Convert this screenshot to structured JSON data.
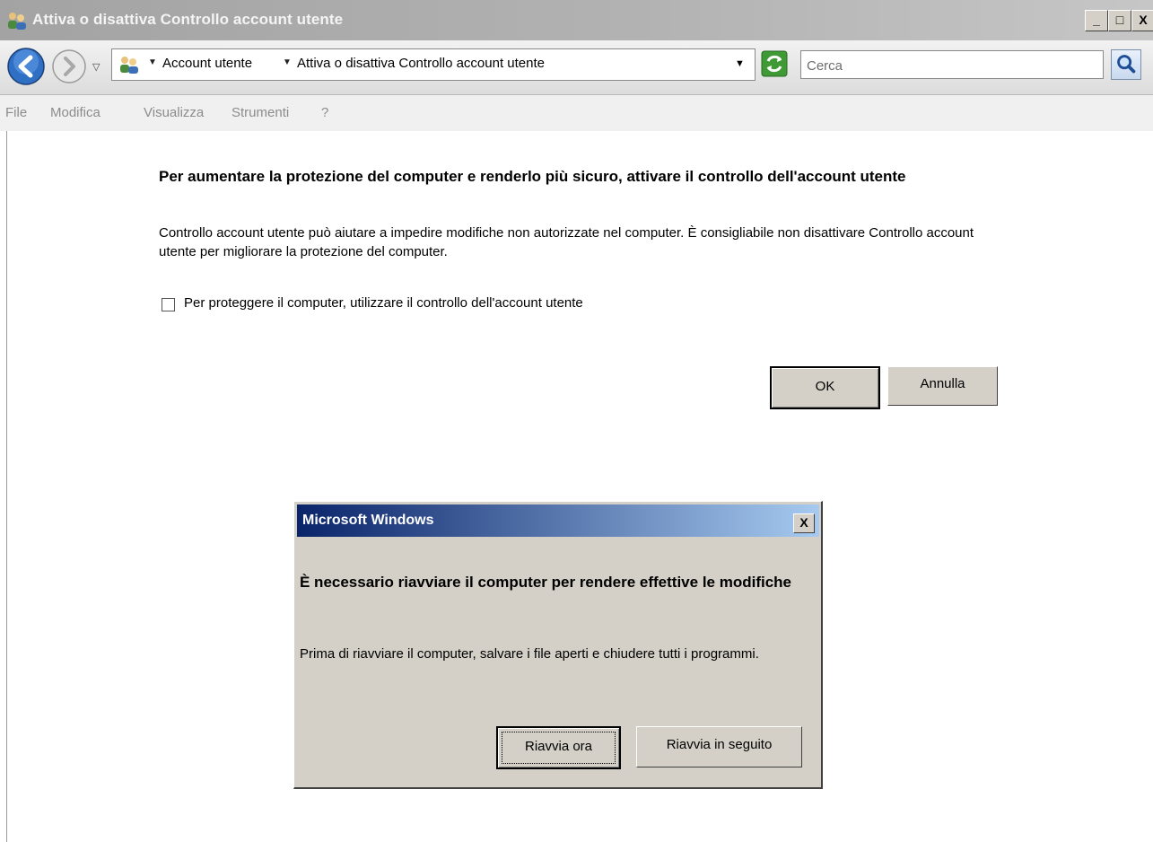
{
  "window": {
    "title": "Attiva o disattiva Controllo account utente",
    "controls": {
      "minimize": "_",
      "maximize": "□",
      "close": "X"
    }
  },
  "addressbar": {
    "breadcrumbs": [
      "Account utente",
      "Attiva o disattiva Controllo account utente"
    ],
    "search_placeholder": "Cerca"
  },
  "menu": {
    "items": [
      "File",
      "Modifica",
      "Visualizza",
      "Strumenti",
      "?"
    ]
  },
  "main": {
    "heading": "Per aumentare la protezione del computer e renderlo più sicuro, attivare il controllo dell'account utente",
    "description": "Controllo account utente può aiutare a impedire modifiche non autorizzate nel computer. È consigliabile non disattivare Controllo account utente per migliorare la protezione del computer.",
    "checkbox_label": "Per proteggere il computer, utilizzare il controllo dell'account utente",
    "checkbox_checked": false,
    "ok_label": "OK",
    "cancel_label": "Annulla"
  },
  "dialog": {
    "title": "Microsoft Windows",
    "close": "X",
    "heading": "È necessario riavviare il computer per rendere effettive le modifiche",
    "text": "Prima di riavviare il computer, salvare i file aperti e chiudere tutti i programmi.",
    "restart_now_label": "Riavvia ora",
    "restart_later_label": "Riavvia in seguito"
  },
  "colors": {
    "dialog_title_start": "#0a246a",
    "dialog_title_end": "#a6caf0",
    "button_face": "#d4d0c8"
  }
}
